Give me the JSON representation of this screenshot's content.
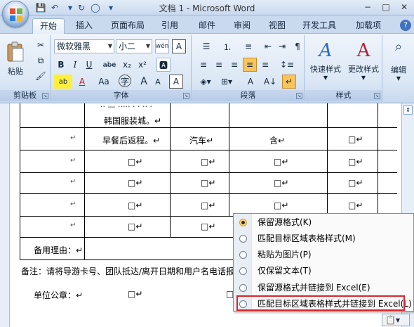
{
  "app": {
    "title": "文档 1 - Microsoft Word",
    "qat": {
      "save": "💾",
      "undo": "↶",
      "redo": "↻",
      "circle": "◯"
    },
    "window": {
      "minimize": "−",
      "maximize": "□",
      "close": "✕"
    }
  },
  "tabs": [
    "开始",
    "插入",
    "页面布局",
    "引用",
    "邮件",
    "审阅",
    "视图",
    "开发工具",
    "加载项"
  ],
  "help": "?",
  "ribbon": {
    "clipboard": {
      "label": "剪贴板",
      "paste": "粘贴",
      "cut": "✂",
      "copy": "⧉",
      "painter": "🖌"
    },
    "font": {
      "label": "字体",
      "font_name": "微软雅黑",
      "font_size": "小二",
      "phonetic": "wén",
      "charbox": "A",
      "bold": "B",
      "italic": "I",
      "underline": "U",
      "strike": "abe",
      "sub": "x₂",
      "sup": "x²",
      "clear": "🅰",
      "highlight": "ab",
      "color": "A",
      "case": "Aa",
      "grow": "A",
      "shrink": "A",
      "border": "A",
      "circle": "字"
    },
    "paragraph": {
      "label": "段落",
      "bullets": "☰",
      "numbers": "⒈",
      "multilevel": "≡",
      "decrease": "⇤",
      "increase": "⇥",
      "cjk": "A",
      "sort": "A↓",
      "marks": "↵",
      "show": "¶"
    },
    "styles": {
      "label": "样式",
      "quick": "快速样式",
      "change": "更改样式"
    },
    "editing": {
      "label": "编辑"
    }
  },
  "table": {
    "rows": [
      {
        "c2": "韩国服装城。↵",
        "c3": "",
        "c4": "",
        "c5": ""
      },
      {
        "c2": "早餐后返程。↵",
        "c3": "汽车↵",
        "c4": "含↵",
        "c5": "□↵"
      },
      {
        "c2": "□↵",
        "c3": "□↵",
        "c4": "□↵",
        "c5": "□↵"
      },
      {
        "c2": "□↵",
        "c3": "□↵",
        "c4": "□↵",
        "c5": "□↵"
      },
      {
        "c2": "□↵",
        "c3": "□↵",
        "c4": "□↵",
        "c5": "□↵"
      },
      {
        "c2": "□↵",
        "c3": "□↵",
        "c4": "",
        "c5": ""
      }
    ],
    "spare_reason": "备用理由：↵",
    "note": "备注：请将导游卡号、团队抵达/离开日期和用户名电话报出",
    "seal": "单位公章：↵",
    "first_col_marks": [
      "↵",
      "↵",
      "↵",
      "↵",
      "↵",
      "↵"
    ]
  },
  "paste_menu": {
    "items": [
      {
        "label": "保留源格式(K)",
        "checked": true
      },
      {
        "label": "匹配目标区域表格样式(M)",
        "checked": false
      },
      {
        "label": "粘贴为图片(P)",
        "checked": false
      },
      {
        "label": "仅保留文本(T)",
        "checked": false
      },
      {
        "label": "保留源格式并链接到 Excel(E)",
        "checked": false
      },
      {
        "label": "匹配目标区域表格样式并链接到 Excel(L)",
        "checked": false,
        "highlighted": true
      }
    ]
  },
  "paste_button": "📋▾",
  "colors": {
    "ribbon": "#dbe7f5",
    "highlight_box": "#d9262c",
    "accent": "#3f72c3"
  }
}
